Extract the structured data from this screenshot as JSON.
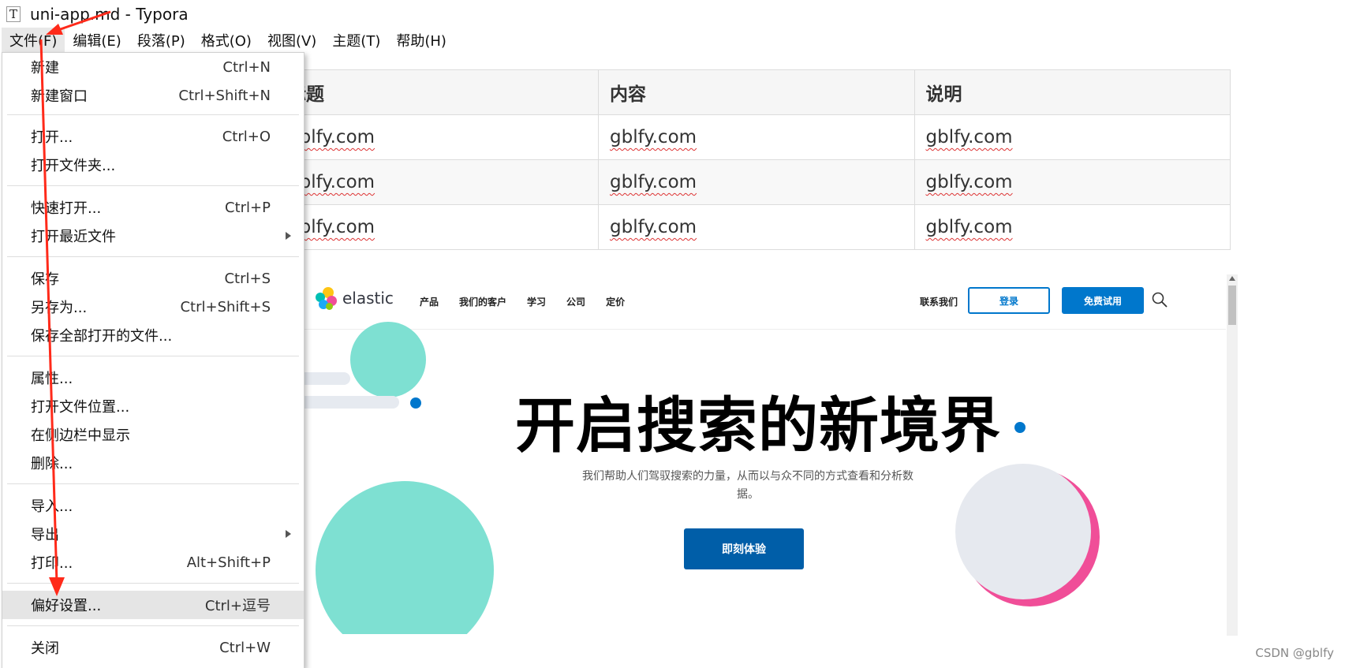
{
  "window": {
    "icon_letter": "T",
    "title": "uni-app.md - Typora"
  },
  "menubar": [
    "文件(F)",
    "编辑(E)",
    "段落(P)",
    "格式(O)",
    "视图(V)",
    "主题(T)",
    "帮助(H)"
  ],
  "table": {
    "headers": [
      "标题",
      "内容",
      "说明"
    ],
    "rows": [
      [
        "gblfy.com",
        "gblfy.com",
        "gblfy.com"
      ],
      [
        "gblfy.com",
        "gblfy.com",
        "gblfy.com"
      ],
      [
        "gblfy.com",
        "gblfy.com",
        "gblfy.com"
      ]
    ]
  },
  "elastic": {
    "logo_text": "elastic",
    "nav": [
      "产品",
      "我们的客户",
      "学习",
      "公司",
      "定价"
    ],
    "contact": "联系我们",
    "login": "登录",
    "trial": "免费试用",
    "headline": "开启搜索的新境界",
    "subtitle": "我们帮助人们驾驭搜索的力量，从而以与众不同的方式查看和分析数据。",
    "cta": "即刻体验",
    "colors": {
      "primary": "#0077cc",
      "cta": "#005ea8",
      "teal": "#7ee0d2",
      "gray_circle": "#e6e9ef",
      "pink": "#f04e98"
    }
  },
  "file_menu": {
    "groups": [
      [
        {
          "label": "新建",
          "shortcut": "Ctrl+N"
        },
        {
          "label": "新建窗口",
          "shortcut": "Ctrl+Shift+N"
        }
      ],
      [
        {
          "label": "打开...",
          "shortcut": "Ctrl+O"
        },
        {
          "label": "打开文件夹...",
          "shortcut": ""
        }
      ],
      [
        {
          "label": "快速打开...",
          "shortcut": "Ctrl+P"
        },
        {
          "label": "打开最近文件",
          "shortcut": "",
          "submenu": true
        }
      ],
      [
        {
          "label": "保存",
          "shortcut": "Ctrl+S"
        },
        {
          "label": "另存为...",
          "shortcut": "Ctrl+Shift+S"
        },
        {
          "label": "保存全部打开的文件...",
          "shortcut": ""
        }
      ],
      [
        {
          "label": "属性...",
          "shortcut": ""
        },
        {
          "label": "打开文件位置...",
          "shortcut": ""
        },
        {
          "label": "在侧边栏中显示",
          "shortcut": ""
        },
        {
          "label": "删除...",
          "shortcut": ""
        }
      ],
      [
        {
          "label": "导入...",
          "shortcut": ""
        },
        {
          "label": "导出",
          "shortcut": "",
          "submenu": true
        },
        {
          "label": "打印...",
          "shortcut": "Alt+Shift+P"
        }
      ],
      [
        {
          "label": "偏好设置...",
          "shortcut": "Ctrl+逗号",
          "highlighted": true
        }
      ],
      [
        {
          "label": "关闭",
          "shortcut": "Ctrl+W"
        }
      ]
    ]
  },
  "annotation": {
    "arrow_color": "#ff2a1a"
  },
  "watermark": "CSDN @gblfy"
}
